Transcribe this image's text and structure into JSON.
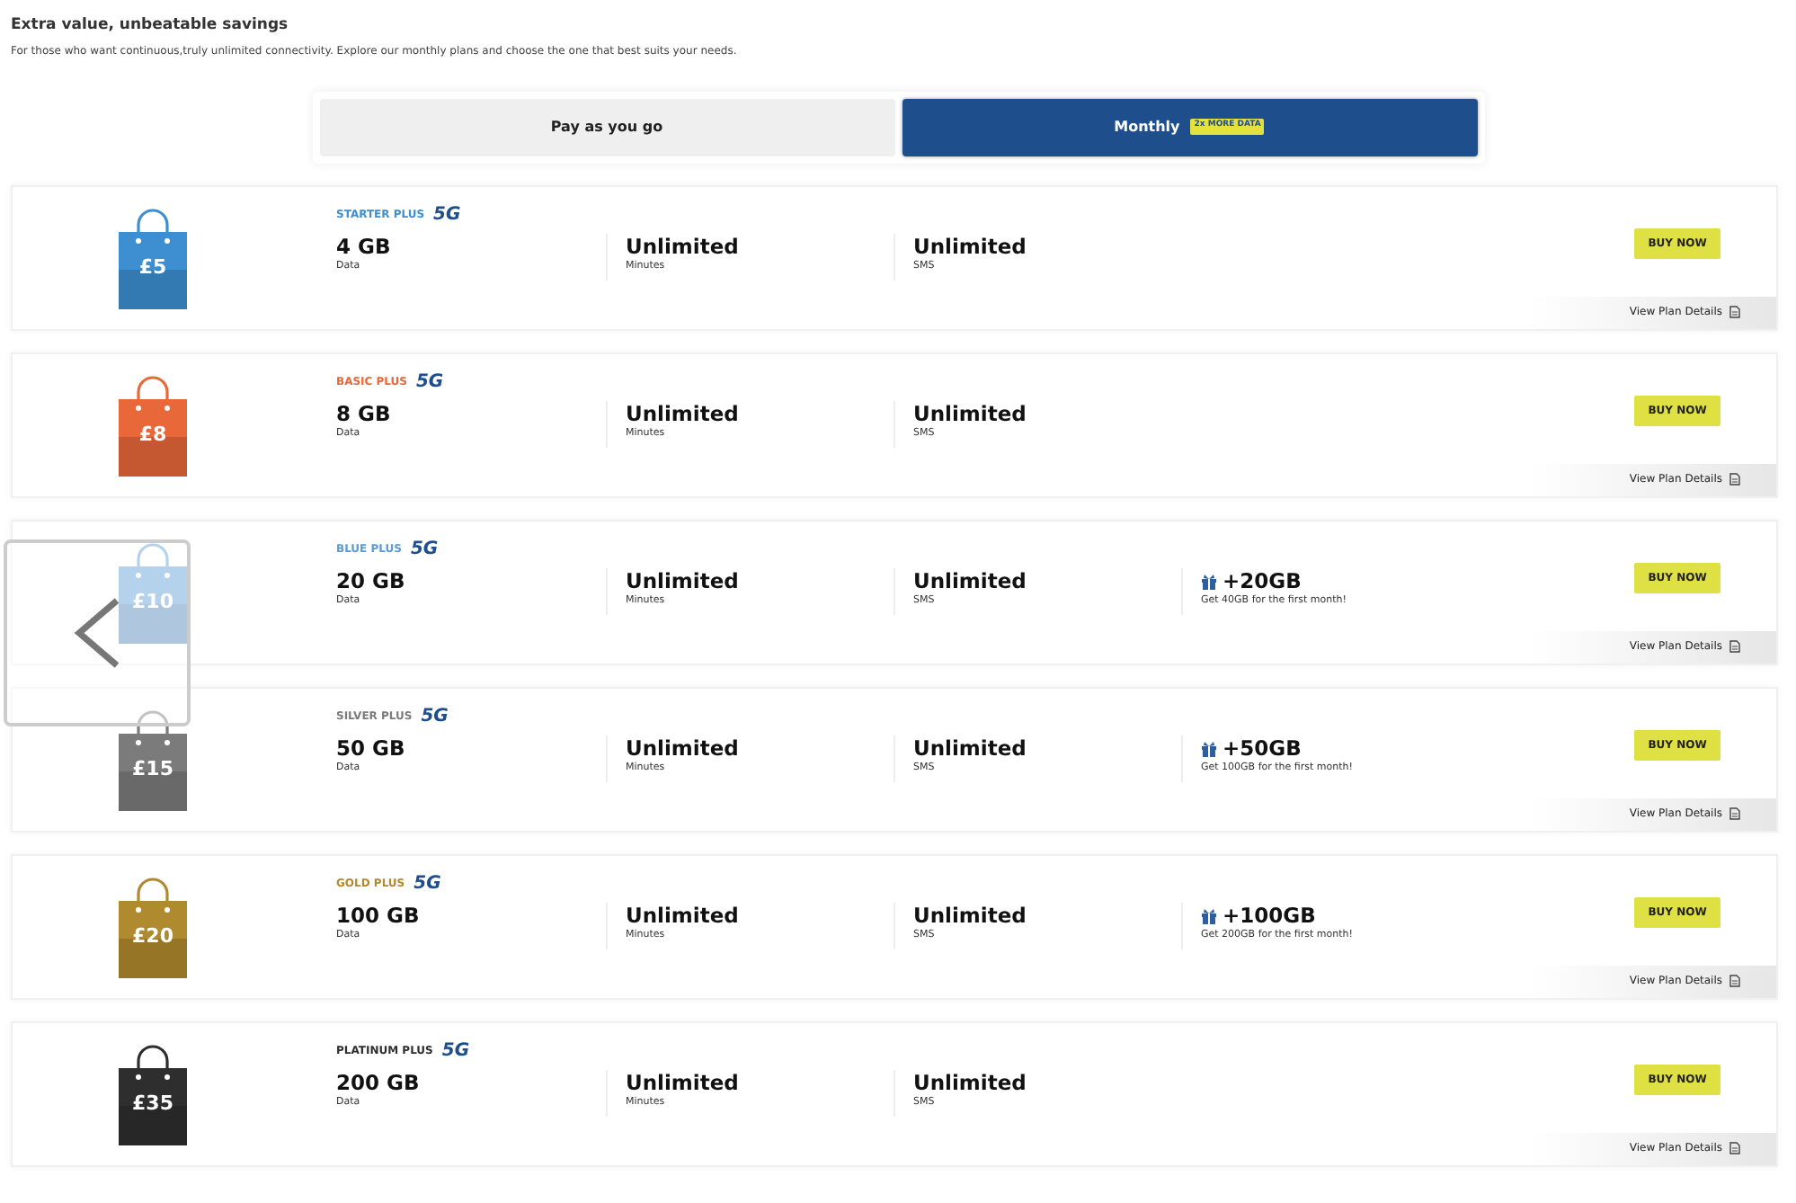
{
  "header": {
    "title": "Extra value, unbeatable savings",
    "description": "For those who want continuous,truly unlimited connectivity. Explore our monthly plans and choose the one that best suits your needs."
  },
  "tabs": [
    {
      "label": "Pay as you go",
      "selected": false
    },
    {
      "label": "Monthly",
      "selected": true,
      "badge": "2x MORE DATA"
    }
  ],
  "plans": [
    {
      "name": "STARTER PLUS",
      "network": "5G",
      "color": "#3d8fd1",
      "price": "£5",
      "data": "4 GB",
      "data_label": "Data",
      "minutes": "Unlimited",
      "minutes_label": "Minutes",
      "sms": "Unlimited",
      "sms_label": "SMS",
      "buy": "BUY NOW",
      "details": "View Plan Details"
    },
    {
      "name": "BASIC PLUS",
      "network": "5G",
      "color": "#e8683a",
      "price": "£8",
      "data": "8 GB",
      "data_label": "Data",
      "minutes": "Unlimited",
      "minutes_label": "Minutes",
      "sms": "Unlimited",
      "sms_label": "SMS",
      "buy": "BUY NOW",
      "details": "View Plan Details"
    },
    {
      "name": "BLUE PLUS",
      "network": "5G",
      "color": "#5b9bd5",
      "price": "£10",
      "data": "20 GB",
      "data_label": "Data",
      "minutes": "Unlimited",
      "minutes_label": "Minutes",
      "sms": "Unlimited",
      "sms_label": "SMS",
      "bonus": "+20GB",
      "bonus_note": "Get 40GB for the first month!",
      "buy": "BUY NOW",
      "details": "View Plan Details"
    },
    {
      "name": "SILVER PLUS",
      "network": "5G",
      "color": "#7b7b7b",
      "price": "£15",
      "data": "50 GB",
      "data_label": "Data",
      "minutes": "Unlimited",
      "minutes_label": "Minutes",
      "sms": "Unlimited",
      "sms_label": "SMS",
      "bonus": "+50GB",
      "bonus_note": "Get 100GB for the first month!",
      "buy": "BUY NOW",
      "details": "View Plan Details"
    },
    {
      "name": "GOLD PLUS",
      "network": "5G",
      "color": "#b08a2e",
      "price": "£20",
      "data": "100 GB",
      "data_label": "Data",
      "minutes": "Unlimited",
      "minutes_label": "Minutes",
      "sms": "Unlimited",
      "sms_label": "SMS",
      "bonus": "+100GB",
      "bonus_note": "Get 200GB for the first month!",
      "buy": "BUY NOW",
      "details": "View Plan Details"
    },
    {
      "name": "PLATINUM PLUS",
      "network": "5G",
      "color": "#2e2e2e",
      "price": "£35",
      "data": "200 GB",
      "data_label": "Data",
      "minutes": "Unlimited",
      "minutes_label": "Minutes",
      "sms": "Unlimited",
      "sms_label": "SMS",
      "buy": "BUY NOW",
      "details": "View Plan Details"
    }
  ],
  "overlay": {
    "kind": "back-arrow"
  }
}
